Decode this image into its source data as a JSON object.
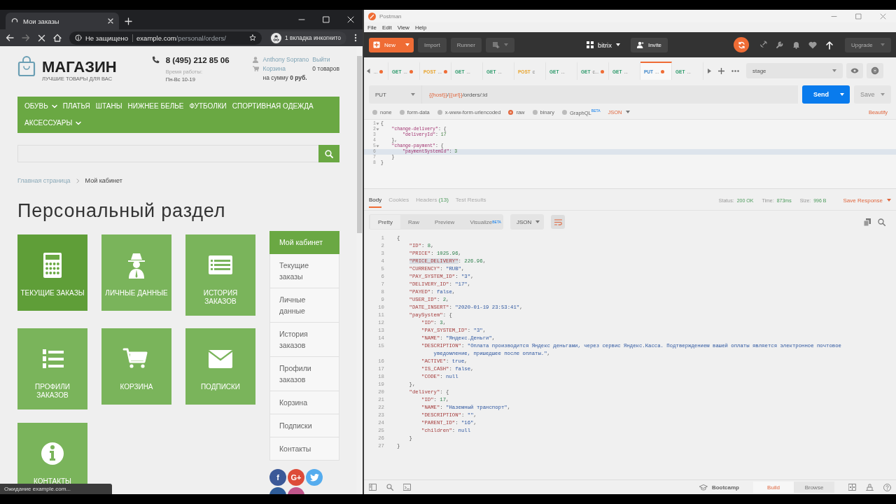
{
  "browser": {
    "tab": {
      "title": "Мои заказы",
      "loading": true
    },
    "address": {
      "security": "Не защищено",
      "host": "example.com",
      "path": "/personal/orders/"
    },
    "incognito": "1 вкладка инкогнито",
    "status": "Ожидание example.com..."
  },
  "shop": {
    "logo": {
      "name": "МАГАЗИН",
      "tagline": "ЛУЧШИЕ ТОВАРЫ ДЛЯ ВАС"
    },
    "phone": "8 (495) 212 85 06",
    "hours_label": "Время работы:",
    "hours": "Пн-Вс 10-19",
    "user": "Anthony Soprano",
    "logout": "Выйти",
    "cart_link": "Корзина",
    "cart_count": "0 товаров",
    "cart_total": "на сумму **0 руб.**",
    "nav": [
      {
        "label": "ОБУВЬ",
        "submenu": true
      },
      {
        "label": "ПЛАТЬЯ",
        "submenu": false
      },
      {
        "label": "ШТАНЫ",
        "submenu": false
      },
      {
        "label": "НИЖНЕЕ БЕЛЬЕ",
        "submenu": false
      },
      {
        "label": "ФУТБОЛКИ",
        "submenu": false
      },
      {
        "label": "СПОРТИВНАЯ ОДЕЖДА",
        "submenu": false
      },
      {
        "label": "АКСЕССУАРЫ",
        "submenu": true
      }
    ],
    "breadcrumb": [
      {
        "label": "Главная страница",
        "link": true
      },
      {
        "label": "Мой кабинет",
        "link": false
      }
    ],
    "title": "Персональный раздел",
    "tiles": [
      {
        "label": "ТЕКУЩИЕ ЗАКАЗЫ",
        "hovered": true
      },
      {
        "label": "ЛИЧНЫЕ ДАННЫЕ",
        "hovered": false
      },
      {
        "label": "ИСТОРИЯ ЗАКАЗОВ",
        "hovered": false
      },
      {
        "label": "ПРОФИЛИ ЗАКАЗОВ",
        "hovered": false
      },
      {
        "label": "КОРЗИНА",
        "hovered": false
      },
      {
        "label": "ПОДПИСКИ",
        "hovered": false
      },
      {
        "label": "КОНТАКТЫ",
        "hovered": false
      }
    ],
    "menu": [
      {
        "label": "Мой кабинет",
        "selected": true
      },
      {
        "label": "Текущие заказы",
        "selected": false
      },
      {
        "label": "Личные данные",
        "selected": false
      },
      {
        "label": "История заказов",
        "selected": false
      },
      {
        "label": "Профили заказов",
        "selected": false
      },
      {
        "label": "Корзина",
        "selected": false
      },
      {
        "label": "Подписки",
        "selected": false
      },
      {
        "label": "Контакты",
        "selected": false
      }
    ],
    "social": [
      {
        "kind": "text",
        "label": "f",
        "color": "#3b5998"
      },
      {
        "kind": "text",
        "label": "G+",
        "color": "#dd4b39"
      },
      {
        "kind": "bird",
        "color": "#55acee"
      },
      {
        "kind": "plain",
        "color": "#2f5d9a"
      },
      {
        "kind": "plain",
        "color": "#c1558b"
      }
    ]
  },
  "postman": {
    "title": "Postman",
    "menu": [
      "File",
      "Edit",
      "View",
      "Help"
    ],
    "toolbar": {
      "new": "New",
      "import": "Import",
      "runner": "Runner",
      "workspace": "bitrix",
      "invite": "Invite",
      "upgrade": "Upgrade"
    },
    "tabs": [
      {
        "name": "...",
        "unsaved": true,
        "selected": false
      },
      {
        "method": "GET",
        "color": "#2d9a6b",
        "name": "...",
        "unsaved": true,
        "selected": false
      },
      {
        "method": "POST",
        "color": "#e8a32a",
        "name": "...",
        "unsaved": true,
        "selected": false
      },
      {
        "method": "GET",
        "color": "#2d9a6b",
        "name": "...",
        "unsaved": false,
        "selected": false
      },
      {
        "method": "GET",
        "color": "#2d9a6b",
        "name": "...",
        "unsaved": false,
        "selected": false
      },
      {
        "method": "POST",
        "color": "#e8a32a",
        "name": "c",
        "unsaved": false,
        "selected": false
      },
      {
        "method": "GET",
        "color": "#2d9a6b",
        "name": "...",
        "unsaved": false,
        "selected": false
      },
      {
        "method": "GET",
        "color": "#2d9a6b",
        "name": "c...",
        "unsaved": true,
        "selected": false
      },
      {
        "method": "GET",
        "color": "#2d9a6b",
        "name": "...",
        "unsaved": false,
        "selected": false
      },
      {
        "method": "PUT",
        "color": "#3b84c9",
        "name": "...",
        "unsaved": true,
        "selected": true
      },
      {
        "method": "GET",
        "color": "#2d9a6b",
        "name": "...",
        "unsaved": false,
        "selected": false
      }
    ],
    "environment": "stage",
    "request": {
      "method": "PUT",
      "url": [
        {
          "text": "{{host}}",
          "variable": true
        },
        {
          "text": "/",
          "variable": false
        },
        {
          "text": "{{url}}",
          "variable": true
        },
        {
          "text": "/orders/:id",
          "variable": false
        }
      ],
      "send": "Send",
      "save": "Save"
    },
    "body_types": [
      {
        "label": "none",
        "selected": false
      },
      {
        "label": "form-data",
        "selected": false
      },
      {
        "label": "x-www-form-urlencoded",
        "selected": false
      },
      {
        "label": "raw",
        "selected": true
      },
      {
        "label": "binary",
        "selected": false
      },
      {
        "label": "GraphQL",
        "badge": "BETA",
        "selected": false
      }
    ],
    "body_format": "JSON",
    "beautify": "Beautify",
    "request_body": [
      {
        "number": "1",
        "text": "{",
        "foldable": true,
        "current": false
      },
      {
        "number": "2",
        "text": "    \"change-delivery\": {",
        "foldable": true,
        "current": false
      },
      {
        "number": "3",
        "text": "        \"deliveryId\": 17",
        "foldable": false,
        "current": false
      },
      {
        "number": "4",
        "text": "    },",
        "foldable": false,
        "current": false
      },
      {
        "number": "5",
        "text": "    \"change-payment\": {",
        "foldable": true,
        "current": false
      },
      {
        "number": "6",
        "text": "        \"paymentSystemId\": 3",
        "foldable": false,
        "current": true
      },
      {
        "number": "7",
        "text": "    }",
        "foldable": false,
        "current": false
      },
      {
        "number": "8",
        "text": "}",
        "foldable": false,
        "current": false
      }
    ],
    "response_tabs": [
      {
        "label": "Body",
        "selected": true
      },
      {
        "label": "Cookies",
        "selected": false
      },
      {
        "label": "Headers",
        "count": "(13)",
        "selected": false
      },
      {
        "label": "Test Results",
        "selected": false
      }
    ],
    "status": {
      "status_label": "Status:",
      "status": "200 OK",
      "time_label": "Time:",
      "time": "873ms",
      "size_label": "Size:",
      "size": "996 B"
    },
    "save_response": "Save Response",
    "view_modes": [
      {
        "label": "Pretty",
        "selected": true
      },
      {
        "label": "Raw",
        "selected": false
      },
      {
        "label": "Preview",
        "selected": false
      },
      {
        "label": "Visualize",
        "badge": "BETA",
        "selected": false
      }
    ],
    "response_format": "JSON",
    "response_body": [
      {
        "number": "1",
        "text": "{"
      },
      {
        "number": "2",
        "text": "    \"ID\": 8,",
        "highlighted": false
      },
      {
        "number": "3",
        "text": "    \"PRICE\": 1025.96,",
        "highlighted": false
      },
      {
        "number": "4",
        "text": "    \"PRICE_DELIVERY\": 226.96,",
        "highlighted": true
      },
      {
        "number": "5",
        "text": "    \"CURRENCY\": \"RUB\",",
        "highlighted": false
      },
      {
        "number": "6",
        "text": "    \"PAY_SYSTEM_ID\": \"3\",",
        "highlighted": false
      },
      {
        "number": "7",
        "text": "    \"DELIVERY_ID\": \"17\",",
        "highlighted": false
      },
      {
        "number": "8",
        "text": "    \"PAYED\": false,",
        "highlighted": false
      },
      {
        "number": "9",
        "text": "    \"USER_ID\": 2,",
        "highlighted": false
      },
      {
        "number": "10",
        "text": "    \"DATE_INSERT\": \"2020-01-19 23:53:41\",",
        "highlighted": false
      },
      {
        "number": "11",
        "text": "    \"paySystem\": {",
        "highlighted": false
      },
      {
        "number": "12",
        "text": "        \"ID\": 3,",
        "highlighted": false
      },
      {
        "number": "13",
        "text": "        \"PAY_SYSTEM_ID\": \"3\",",
        "highlighted": false
      },
      {
        "number": "14",
        "text": "        \"NAME\": \"Яндекс.Деньги\",",
        "highlighted": false
      },
      {
        "number": "15",
        "text": "        \"DESCRIPTION\": \"Оплата производится Яндекс деньгами, через сервис Яндекс.Касса. Подтверждением вашей оплаты является электронное почтовое уведомление, пришедшее после оплаты.\",",
        "highlighted": false
      },
      {
        "number": "16",
        "text": "        \"ACTIVE\": true,",
        "highlighted": false
      },
      {
        "number": "17",
        "text": "        \"IS_CASH\": false,",
        "highlighted": false
      },
      {
        "number": "18",
        "text": "        \"CODE\": null",
        "highlighted": false
      },
      {
        "number": "19",
        "text": "    },"
      },
      {
        "number": "20",
        "text": "    \"delivery\": {",
        "highlighted": false
      },
      {
        "number": "21",
        "text": "        \"ID\": 17,",
        "highlighted": false
      },
      {
        "number": "22",
        "text": "        \"NAME\": \"Наземный транспорт\",",
        "highlighted": false
      },
      {
        "number": "23",
        "text": "        \"DESCRIPTION\": \"\",",
        "highlighted": false
      },
      {
        "number": "24",
        "text": "        \"PARENT_ID\": \"16\",",
        "highlighted": false
      },
      {
        "number": "25",
        "text": "        \"children\": null",
        "highlighted": false
      },
      {
        "number": "26",
        "text": "    }"
      },
      {
        "number": "27",
        "text": "}"
      }
    ],
    "footer": {
      "bootcamp": "Bootcamp",
      "modes": [
        {
          "label": "Build",
          "selected": true
        },
        {
          "label": "Browse",
          "selected": false
        }
      ]
    }
  }
}
